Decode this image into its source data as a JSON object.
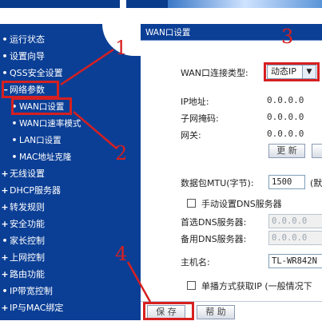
{
  "colors": {
    "sidebar": "#0b3f96",
    "highlight": "#d62020",
    "panel_head": "#0b3f96"
  },
  "sidebar": {
    "items": [
      {
        "label": "运行状态",
        "bullet": "•"
      },
      {
        "label": "设置向导",
        "bullet": "•"
      },
      {
        "label": "QSS安全设置",
        "bullet": "•"
      },
      {
        "label": "网络参数",
        "bullet": "−"
      },
      {
        "label": "WAN口设置",
        "bullet": "•"
      },
      {
        "label": "WAN口速率模式",
        "bullet": "•"
      },
      {
        "label": "LAN口设置",
        "bullet": "•"
      },
      {
        "label": "MAC地址克隆",
        "bullet": "•"
      },
      {
        "label": "无线设置",
        "bullet": "+"
      },
      {
        "label": "DHCP服务器",
        "bullet": "+"
      },
      {
        "label": "转发规则",
        "bullet": "+"
      },
      {
        "label": "安全功能",
        "bullet": "+"
      },
      {
        "label": "家长控制",
        "bullet": "•"
      },
      {
        "label": "上网控制",
        "bullet": "+"
      },
      {
        "label": "路由功能",
        "bullet": "+"
      },
      {
        "label": "IP带宽控制",
        "bullet": "•"
      },
      {
        "label": "IP与MAC绑定",
        "bullet": "+"
      }
    ]
  },
  "panel": {
    "title": "WAN口设置",
    "wan_type_label": "WAN口连接类型:",
    "wan_type_value": "动态IP",
    "ip_label": "IP地址:",
    "ip_value": "0.0.0.0",
    "mask_label": "子网掩码:",
    "mask_value": "0.0.0.0",
    "gateway_label": "网关:",
    "gateway_value": "0.0.0.0",
    "refresh_button": "更 新",
    "mtu_label": "数据包MTU(字节):",
    "mtu_value": "1500",
    "mtu_suffix": "(默",
    "manual_dns_label": "手动设置DNS服务器",
    "primary_dns_label": "首选DNS服务器:",
    "primary_dns_value": "0.0.0.0",
    "secondary_dns_label": "备用DNS服务器:",
    "secondary_dns_value": "0.0.0.0",
    "hostname_label": "主机名:",
    "hostname_value": "TL-WR842N",
    "unicast_label": "单播方式获取IP (一般情况下",
    "save_button": "保 存",
    "help_button": "帮 助"
  },
  "annotations": {
    "n1": "1",
    "n2": "2",
    "n3": "3",
    "n4": "4"
  }
}
